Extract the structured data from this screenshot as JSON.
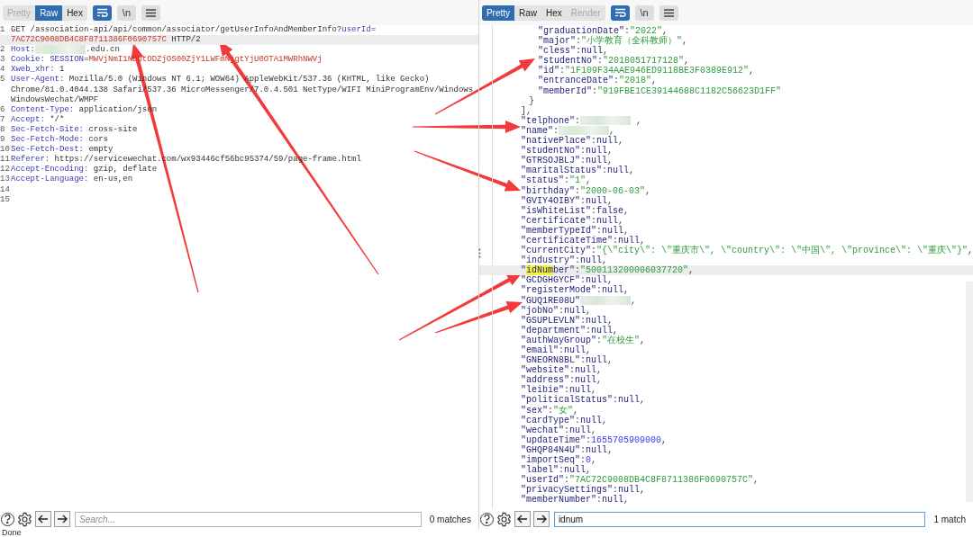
{
  "request": {
    "tabs": [
      {
        "label": "Pretty",
        "selected": false,
        "disabled": true
      },
      {
        "label": "Raw",
        "selected": true,
        "disabled": false
      },
      {
        "label": "Hex",
        "selected": false,
        "disabled": false
      }
    ],
    "tool_buttons": [
      {
        "kind": "wrap",
        "on": true
      },
      {
        "kind": "newline",
        "label": "\\n",
        "on": false
      },
      {
        "kind": "menu",
        "on": false
      }
    ],
    "lines": [
      {
        "number": "1",
        "highlighted": true,
        "rows": [
          {
            "segments": [
              {
                "kind": "plain",
                "text": "GET /association-api/api/common/associator/getUserInfoAndMemberInfo?"
              },
              {
                "kind": "param",
                "text": "userId"
              },
              {
                "kind": "plain",
                "text": "="
              }
            ]
          },
          {
            "segments": [
              {
                "kind": "value",
                "text": "7AC72C9008DB4C8F8711386F0690757C"
              },
              {
                "kind": "plain",
                "text": " HTTP/2"
              }
            ]
          }
        ]
      },
      {
        "number": "2",
        "highlighted": false,
        "rows": [
          {
            "segments": [
              {
                "kind": "header",
                "text": "Host:"
              },
              {
                "kind": "redacted"
              },
              {
                "kind": "plain",
                "text": ".edu.cn"
              }
            ]
          }
        ]
      },
      {
        "number": "3",
        "highlighted": false,
        "rows": [
          {
            "segments": [
              {
                "kind": "header",
                "text": "Cookie: SESSION"
              },
              {
                "kind": "plain",
                "text": "="
              },
              {
                "kind": "value",
                "text": "MWVjNmI1NDUtODZjOS00ZjY1LWFmNjgtYjU0OTA1MWRhNWVj"
              }
            ]
          }
        ]
      },
      {
        "number": "4",
        "highlighted": false,
        "rows": [
          {
            "segments": [
              {
                "kind": "header",
                "text": "Xweb_xhr:"
              },
              {
                "kind": "plain",
                "text": " 1"
              }
            ]
          }
        ]
      },
      {
        "number": "5",
        "highlighted": false,
        "rows": [
          {
            "segments": [
              {
                "kind": "header",
                "text": "User-Agent:"
              },
              {
                "kind": "plain",
                "text": " Mozilla/5.0 (Windows NT 6.1; WOW64) AppleWebKit/537.36 (KHTML, like Gecko)"
              }
            ]
          },
          {
            "segments": [
              {
                "kind": "plain",
                "text": "Chrome/81.0.4044.138 Safari/537.36 MicroMessenger/7.0.4.501 NetType/WIFI MiniProgramEnv/Windows"
              }
            ]
          },
          {
            "segments": [
              {
                "kind": "plain",
                "text": "WindowsWechat/WMPF"
              }
            ]
          }
        ]
      },
      {
        "number": "6",
        "highlighted": false,
        "rows": [
          {
            "segments": [
              {
                "kind": "header",
                "text": "Content-Type:"
              },
              {
                "kind": "plain",
                "text": " application/json"
              }
            ]
          }
        ]
      },
      {
        "number": "7",
        "highlighted": false,
        "rows": [
          {
            "segments": [
              {
                "kind": "header",
                "text": "Accept:"
              },
              {
                "kind": "plain",
                "text": " */*"
              }
            ]
          }
        ]
      },
      {
        "number": "8",
        "highlighted": false,
        "rows": [
          {
            "segments": [
              {
                "kind": "header",
                "text": "Sec-Fetch-Site:"
              },
              {
                "kind": "plain",
                "text": " cross-site"
              }
            ]
          }
        ]
      },
      {
        "number": "9",
        "highlighted": false,
        "rows": [
          {
            "segments": [
              {
                "kind": "header",
                "text": "Sec-Fetch-Mode:"
              },
              {
                "kind": "plain",
                "text": " cors"
              }
            ]
          }
        ]
      },
      {
        "number": "10",
        "highlighted": false,
        "rows": [
          {
            "segments": [
              {
                "kind": "header",
                "text": "Sec-Fetch-Dest:"
              },
              {
                "kind": "plain",
                "text": " empty"
              }
            ]
          }
        ]
      },
      {
        "number": "11",
        "highlighted": false,
        "rows": [
          {
            "segments": [
              {
                "kind": "header",
                "text": "Referer:"
              },
              {
                "kind": "plain",
                "text": " https://servicewechat.com/wx93446cf56bc95374/59/page-frame.html"
              }
            ]
          }
        ]
      },
      {
        "number": "12",
        "highlighted": false,
        "rows": [
          {
            "segments": [
              {
                "kind": "header",
                "text": "Accept-Encoding:"
              },
              {
                "kind": "plain",
                "text": " gzip, deflate"
              }
            ]
          }
        ]
      },
      {
        "number": "13",
        "highlighted": false,
        "rows": [
          {
            "segments": [
              {
                "kind": "header",
                "text": "Accept-Language:"
              },
              {
                "kind": "plain",
                "text": " en-us,en"
              }
            ]
          }
        ]
      },
      {
        "number": "14",
        "highlighted": false
      },
      {
        "number": "15",
        "highlighted": false
      }
    ],
    "search": {
      "placeholder": "Search...",
      "focused": false,
      "matches": "0 matches"
    }
  },
  "response": {
    "tabs": [
      {
        "label": "Pretty",
        "selected": true,
        "disabled": false
      },
      {
        "label": "Raw",
        "selected": false,
        "disabled": false
      },
      {
        "label": "Hex",
        "selected": false,
        "disabled": false
      },
      {
        "label": "Render",
        "selected": false,
        "disabled": true
      }
    ],
    "tool_buttons": [
      {
        "kind": "wrap",
        "on": true
      },
      {
        "kind": "newline",
        "label": "\\n",
        "on": false
      },
      {
        "kind": "menu",
        "on": false
      }
    ],
    "blocks": [
      {
        "kind": "nested",
        "lines": [
          {
            "highlighted": false,
            "segments": [
              {
                "kind": "key",
                "text": "\"graduationDate\""
              },
              {
                "kind": "punct",
                "text": ":"
              },
              {
                "kind": "string",
                "text": "\"2022\""
              },
              {
                "kind": "punct",
                "text": ","
              }
            ]
          },
          {
            "highlighted": false,
            "segments": [
              {
                "kind": "key",
                "text": "\"major\""
              },
              {
                "kind": "punct",
                "text": ":"
              },
              {
                "kind": "string",
                "text": "\"小学教育（全科教师）\""
              },
              {
                "kind": "punct",
                "text": ","
              }
            ]
          },
          {
            "highlighted": false,
            "segments": [
              {
                "kind": "key",
                "text": "\"cless\""
              },
              {
                "kind": "punct",
                "text": ":"
              },
              {
                "kind": "literal",
                "text": "null"
              },
              {
                "kind": "punct",
                "text": ","
              }
            ]
          },
          {
            "highlighted": false,
            "segments": [
              {
                "kind": "key",
                "text": "\"studentNo\""
              },
              {
                "kind": "punct",
                "text": ":"
              },
              {
                "kind": "string",
                "text": "\"2018051717128\""
              },
              {
                "kind": "punct",
                "text": ","
              }
            ]
          },
          {
            "highlighted": false,
            "segments": [
              {
                "kind": "key",
                "text": "\"id\""
              },
              {
                "kind": "punct",
                "text": ":"
              },
              {
                "kind": "string",
                "text": "\"1F109F34AAE946ED9118BE3F0389E912\""
              },
              {
                "kind": "punct",
                "text": ","
              }
            ]
          },
          {
            "highlighted": false,
            "segments": [
              {
                "kind": "key",
                "text": "\"entranceDate\""
              },
              {
                "kind": "punct",
                "text": ":"
              },
              {
                "kind": "string",
                "text": "\"2018\""
              },
              {
                "kind": "punct",
                "text": ","
              }
            ]
          },
          {
            "highlighted": false,
            "segments": [
              {
                "kind": "key",
                "text": "\"memberId\""
              },
              {
                "kind": "punct",
                "text": ":"
              },
              {
                "kind": "string",
                "text": "\"919FBE1CE39144688C1182C56623D1FF\""
              }
            ]
          }
        ]
      },
      {
        "kind": "close",
        "lines": [
          {
            "highlighted": false,
            "segments": [
              {
                "kind": "punct",
                "text": "}"
              }
            ]
          }
        ]
      },
      {
        "kind": "top",
        "lines": [
          {
            "highlighted": false,
            "segments": [
              {
                "kind": "punct",
                "text": "],"
              }
            ]
          },
          {
            "highlighted": false,
            "segments": [
              {
                "kind": "key",
                "text": "\"telphone\""
              },
              {
                "kind": "punct",
                "text": ":"
              },
              {
                "kind": "redacted"
              },
              {
                "kind": "punct",
                "text": " ,"
              }
            ]
          },
          {
            "highlighted": false,
            "segments": [
              {
                "kind": "key",
                "text": "\"name\""
              },
              {
                "kind": "punct",
                "text": ":"
              },
              {
                "kind": "redacted"
              },
              {
                "kind": "punct",
                "text": ","
              }
            ]
          },
          {
            "highlighted": false,
            "segments": [
              {
                "kind": "key",
                "text": "\"nativePlace\""
              },
              {
                "kind": "punct",
                "text": ":"
              },
              {
                "kind": "literal",
                "text": "null"
              },
              {
                "kind": "punct",
                "text": ","
              }
            ]
          },
          {
            "highlighted": false,
            "segments": [
              {
                "kind": "key",
                "text": "\"studentNo\""
              },
              {
                "kind": "punct",
                "text": ":"
              },
              {
                "kind": "literal",
                "text": "null"
              },
              {
                "kind": "punct",
                "text": ","
              }
            ]
          },
          {
            "highlighted": false,
            "segments": [
              {
                "kind": "key",
                "text": "\"GTRSOJBLJ\""
              },
              {
                "kind": "punct",
                "text": ":"
              },
              {
                "kind": "literal",
                "text": "null"
              },
              {
                "kind": "punct",
                "text": ","
              }
            ]
          },
          {
            "highlighted": false,
            "segments": [
              {
                "kind": "key",
                "text": "\"maritalStatus\""
              },
              {
                "kind": "punct",
                "text": ":"
              },
              {
                "kind": "literal",
                "text": "null"
              },
              {
                "kind": "punct",
                "text": ","
              }
            ]
          },
          {
            "highlighted": false,
            "segments": [
              {
                "kind": "key",
                "text": "\"status\""
              },
              {
                "kind": "punct",
                "text": ":"
              },
              {
                "kind": "string",
                "text": "\"1\""
              },
              {
                "kind": "punct",
                "text": ","
              }
            ]
          },
          {
            "highlighted": false,
            "segments": [
              {
                "kind": "key",
                "text": "\"birthday\""
              },
              {
                "kind": "punct",
                "text": ":"
              },
              {
                "kind": "string",
                "text": "\"2000-06-03\""
              },
              {
                "kind": "punct",
                "text": ","
              }
            ]
          },
          {
            "highlighted": false,
            "segments": [
              {
                "kind": "key",
                "text": "\"GVIY4OIBY\""
              },
              {
                "kind": "punct",
                "text": ":"
              },
              {
                "kind": "literal",
                "text": "null"
              },
              {
                "kind": "punct",
                "text": ","
              }
            ]
          },
          {
            "highlighted": false,
            "segments": [
              {
                "kind": "key",
                "text": "\"isWhiteList\""
              },
              {
                "kind": "punct",
                "text": ":"
              },
              {
                "kind": "literal",
                "text": "false"
              },
              {
                "kind": "punct",
                "text": ","
              }
            ]
          },
          {
            "highlighted": false,
            "segments": [
              {
                "kind": "key",
                "text": "\"certificate\""
              },
              {
                "kind": "punct",
                "text": ":"
              },
              {
                "kind": "literal",
                "text": "null"
              },
              {
                "kind": "punct",
                "text": ","
              }
            ]
          },
          {
            "highlighted": false,
            "segments": [
              {
                "kind": "key",
                "text": "\"memberTypeId\""
              },
              {
                "kind": "punct",
                "text": ":"
              },
              {
                "kind": "literal",
                "text": "null"
              },
              {
                "kind": "punct",
                "text": ","
              }
            ]
          },
          {
            "highlighted": false,
            "segments": [
              {
                "kind": "key",
                "text": "\"certificateTime\""
              },
              {
                "kind": "punct",
                "text": ":"
              },
              {
                "kind": "literal",
                "text": "null"
              },
              {
                "kind": "punct",
                "text": ","
              }
            ]
          },
          {
            "highlighted": false,
            "segments": [
              {
                "kind": "key",
                "text": "\"currentCity\""
              },
              {
                "kind": "punct",
                "text": ":"
              },
              {
                "kind": "string",
                "text": "\"{\\\"city\\\": \\\"重庆市\\\", \\\"country\\\": \\\"中国\\\", \\\"province\\\": \\\"重庆\\\"}\""
              },
              {
                "kind": "punct",
                "text": ","
              }
            ]
          },
          {
            "highlighted": false,
            "segments": [
              {
                "kind": "key",
                "text": "\"industry\""
              },
              {
                "kind": "punct",
                "text": ":"
              },
              {
                "kind": "literal",
                "text": "null"
              },
              {
                "kind": "punct",
                "text": ","
              }
            ]
          },
          {
            "highlighted": true,
            "segments": [
              {
                "kind": "key",
                "text": "\""
              },
              {
                "kind": "match",
                "text": "idNum"
              },
              {
                "kind": "key",
                "text": "ber\""
              },
              {
                "kind": "punct",
                "text": ":"
              },
              {
                "kind": "string",
                "text": "\"500113200006037720\""
              },
              {
                "kind": "punct",
                "text": ","
              }
            ]
          },
          {
            "highlighted": false,
            "segments": [
              {
                "kind": "key",
                "text": "\"GCDGHGYCF\""
              },
              {
                "kind": "punct",
                "text": ":"
              },
              {
                "kind": "literal",
                "text": "null"
              },
              {
                "kind": "punct",
                "text": ","
              }
            ]
          },
          {
            "highlighted": false,
            "segments": [
              {
                "kind": "key",
                "text": "\"registerMode\""
              },
              {
                "kind": "punct",
                "text": ":"
              },
              {
                "kind": "literal",
                "text": "null"
              },
              {
                "kind": "punct",
                "text": ","
              }
            ]
          },
          {
            "highlighted": false,
            "segments": [
              {
                "kind": "key",
                "text": "\"GUQ1RE08U\""
              },
              {
                "kind": "redacted"
              },
              {
                "kind": "punct",
                "text": ","
              }
            ]
          },
          {
            "highlighted": false,
            "segments": [
              {
                "kind": "key",
                "text": "\"jobNo\""
              },
              {
                "kind": "punct",
                "text": ":"
              },
              {
                "kind": "literal",
                "text": "null"
              },
              {
                "kind": "punct",
                "text": ","
              }
            ]
          },
          {
            "highlighted": false,
            "segments": [
              {
                "kind": "key",
                "text": "\"GSUPLEVLN\""
              },
              {
                "kind": "punct",
                "text": ":"
              },
              {
                "kind": "literal",
                "text": "null"
              },
              {
                "kind": "punct",
                "text": ","
              }
            ]
          },
          {
            "highlighted": false,
            "segments": [
              {
                "kind": "key",
                "text": "\"department\""
              },
              {
                "kind": "punct",
                "text": ":"
              },
              {
                "kind": "literal",
                "text": "null"
              },
              {
                "kind": "punct",
                "text": ","
              }
            ]
          },
          {
            "highlighted": false,
            "segments": [
              {
                "kind": "key",
                "text": "\"authWayGroup\""
              },
              {
                "kind": "punct",
                "text": ":"
              },
              {
                "kind": "string",
                "text": "\"在校生\""
              },
              {
                "kind": "punct",
                "text": ","
              }
            ]
          },
          {
            "highlighted": false,
            "segments": [
              {
                "kind": "key",
                "text": "\"email\""
              },
              {
                "kind": "punct",
                "text": ":"
              },
              {
                "kind": "literal",
                "text": "null"
              },
              {
                "kind": "punct",
                "text": ","
              }
            ]
          },
          {
            "highlighted": false,
            "segments": [
              {
                "kind": "key",
                "text": "\"GNEORN8BL\""
              },
              {
                "kind": "punct",
                "text": ":"
              },
              {
                "kind": "literal",
                "text": "null"
              },
              {
                "kind": "punct",
                "text": ","
              }
            ]
          },
          {
            "highlighted": false,
            "segments": [
              {
                "kind": "key",
                "text": "\"website\""
              },
              {
                "kind": "punct",
                "text": ":"
              },
              {
                "kind": "literal",
                "text": "null"
              },
              {
                "kind": "punct",
                "text": ","
              }
            ]
          },
          {
            "highlighted": false,
            "segments": [
              {
                "kind": "key",
                "text": "\"address\""
              },
              {
                "kind": "punct",
                "text": ":"
              },
              {
                "kind": "literal",
                "text": "null"
              },
              {
                "kind": "punct",
                "text": ","
              }
            ]
          },
          {
            "highlighted": false,
            "segments": [
              {
                "kind": "key",
                "text": "\"leibie\""
              },
              {
                "kind": "punct",
                "text": ":"
              },
              {
                "kind": "literal",
                "text": "null"
              },
              {
                "kind": "punct",
                "text": ","
              }
            ]
          },
          {
            "highlighted": false,
            "segments": [
              {
                "kind": "key",
                "text": "\"politicalStatus\""
              },
              {
                "kind": "punct",
                "text": ":"
              },
              {
                "kind": "literal",
                "text": "null"
              },
              {
                "kind": "punct",
                "text": ","
              }
            ]
          },
          {
            "highlighted": false,
            "segments": [
              {
                "kind": "key",
                "text": "\"sex\""
              },
              {
                "kind": "punct",
                "text": ":"
              },
              {
                "kind": "string",
                "text": "\"女\""
              },
              {
                "kind": "punct",
                "text": ","
              }
            ]
          },
          {
            "highlighted": false,
            "segments": [
              {
                "kind": "key",
                "text": "\"cardType\""
              },
              {
                "kind": "punct",
                "text": ":"
              },
              {
                "kind": "literal",
                "text": "null"
              },
              {
                "kind": "punct",
                "text": ","
              }
            ]
          },
          {
            "highlighted": false,
            "segments": [
              {
                "kind": "key",
                "text": "\"wechat\""
              },
              {
                "kind": "punct",
                "text": ":"
              },
              {
                "kind": "literal",
                "text": "null"
              },
              {
                "kind": "punct",
                "text": ","
              }
            ]
          },
          {
            "highlighted": false,
            "segments": [
              {
                "kind": "key",
                "text": "\"updateTime\""
              },
              {
                "kind": "punct",
                "text": ":"
              },
              {
                "kind": "number",
                "text": "1655705909000"
              },
              {
                "kind": "punct",
                "text": ","
              }
            ]
          },
          {
            "highlighted": false,
            "segments": [
              {
                "kind": "key",
                "text": "\"GHQP84N4U\""
              },
              {
                "kind": "punct",
                "text": ":"
              },
              {
                "kind": "literal",
                "text": "null"
              },
              {
                "kind": "punct",
                "text": ","
              }
            ]
          },
          {
            "highlighted": false,
            "segments": [
              {
                "kind": "key",
                "text": "\"importSeq\""
              },
              {
                "kind": "punct",
                "text": ":"
              },
              {
                "kind": "number",
                "text": "0"
              },
              {
                "kind": "punct",
                "text": ","
              }
            ]
          },
          {
            "highlighted": false,
            "segments": [
              {
                "kind": "key",
                "text": "\"label\""
              },
              {
                "kind": "punct",
                "text": ":"
              },
              {
                "kind": "literal",
                "text": "null"
              },
              {
                "kind": "punct",
                "text": ","
              }
            ]
          },
          {
            "highlighted": false,
            "segments": [
              {
                "kind": "key",
                "text": "\"userId\""
              },
              {
                "kind": "punct",
                "text": ":"
              },
              {
                "kind": "string",
                "text": "\"7AC72C9008DB4C8F8711386F0690757C\""
              },
              {
                "kind": "punct",
                "text": ","
              }
            ]
          },
          {
            "highlighted": false,
            "segments": [
              {
                "kind": "key",
                "text": "\"privacySettings\""
              },
              {
                "kind": "punct",
                "text": ":"
              },
              {
                "kind": "literal",
                "text": "null"
              },
              {
                "kind": "punct",
                "text": ","
              }
            ]
          },
          {
            "highlighted": false,
            "segments": [
              {
                "kind": "key",
                "text": "\"memberNumber\""
              },
              {
                "kind": "punct",
                "text": ":"
              },
              {
                "kind": "literal",
                "text": "null"
              },
              {
                "kind": "punct",
                "text": ","
              }
            ]
          }
        ]
      }
    ],
    "search": {
      "value": "idnum",
      "focused": true,
      "matches": "1 match"
    }
  },
  "status_bar": "Done"
}
